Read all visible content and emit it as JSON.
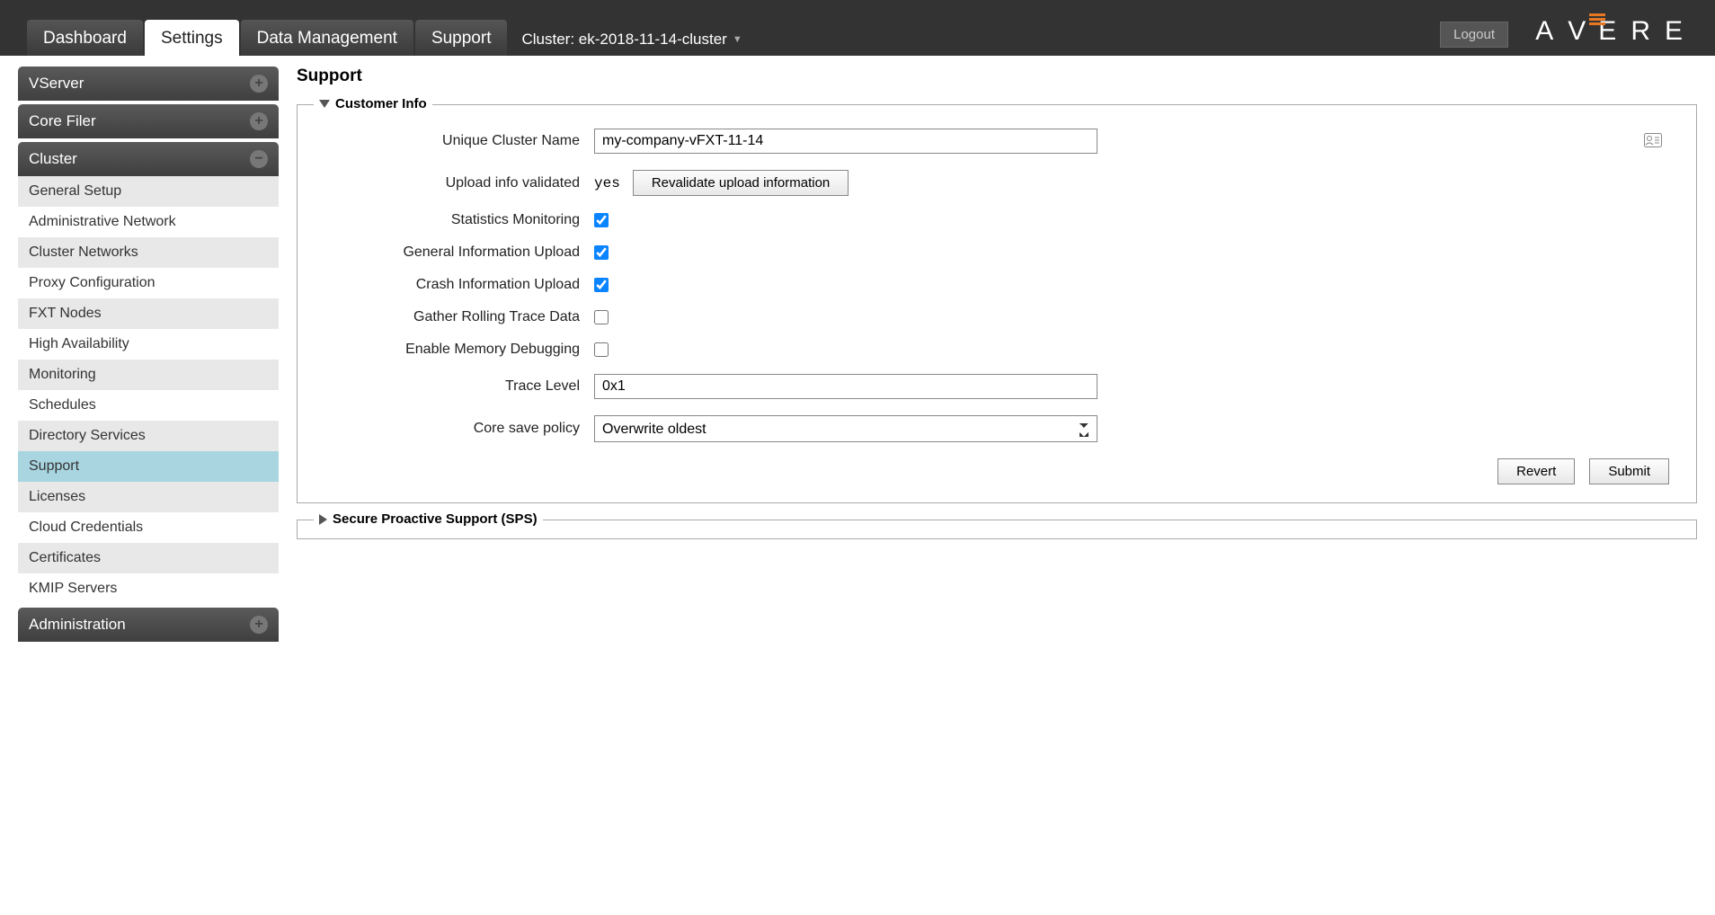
{
  "header": {
    "logout": "Logout",
    "logo_letters": [
      "A",
      "V",
      "E",
      "R",
      "E"
    ]
  },
  "tabs": {
    "dashboard": "Dashboard",
    "settings": "Settings",
    "data_mgmt": "Data Management",
    "support": "Support",
    "cluster_label": "Cluster: ek-2018-11-14-cluster"
  },
  "sidebar": {
    "sections": {
      "vserver": "VServer",
      "core_filer": "Core Filer",
      "cluster": "Cluster",
      "administration": "Administration"
    },
    "cluster_items": [
      "General Setup",
      "Administrative Network",
      "Cluster Networks",
      "Proxy Configuration",
      "FXT Nodes",
      "High Availability",
      "Monitoring",
      "Schedules",
      "Directory Services",
      "Support",
      "Licenses",
      "Cloud Credentials",
      "Certificates",
      "KMIP Servers"
    ]
  },
  "page": {
    "title": "Support",
    "customer_info_legend": "Customer Info",
    "sps_legend": "Secure Proactive Support (SPS)",
    "labels": {
      "cluster_name": "Unique Cluster Name",
      "upload_validated": "Upload info validated",
      "stats_mon": "Statistics Monitoring",
      "gen_info": "General Information Upload",
      "crash_info": "Crash Information Upload",
      "rolling_trace": "Gather Rolling Trace Data",
      "mem_debug": "Enable Memory Debugging",
      "trace_level": "Trace Level",
      "core_save": "Core save policy"
    },
    "values": {
      "cluster_name": "my-company-vFXT-11-14",
      "validated": "yes",
      "revalidate_btn": "Revalidate upload information",
      "trace_level": "0x1",
      "core_save": "Overwrite oldest",
      "stats_mon": true,
      "gen_info": true,
      "crash_info": true,
      "rolling_trace": false,
      "mem_debug": false
    },
    "buttons": {
      "revert": "Revert",
      "submit": "Submit"
    }
  }
}
